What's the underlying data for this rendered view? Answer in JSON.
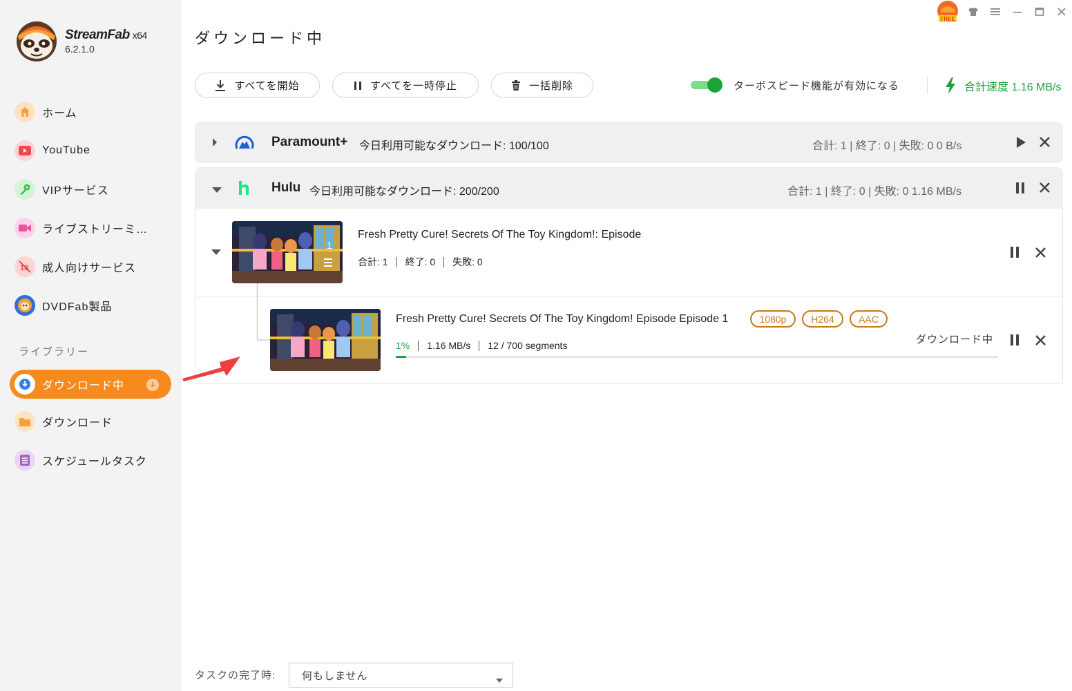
{
  "app": {
    "brand": "StreamFab",
    "arch": "x64",
    "version": "6.2.1.0"
  },
  "sidebar": {
    "items": [
      {
        "label": "ホーム",
        "icon": "home-icon",
        "color": "#f7a13b"
      },
      {
        "label": "YouTube",
        "icon": "youtube-icon",
        "color": "#f0484c"
      },
      {
        "label": "VIPサービス",
        "icon": "key-icon",
        "color": "#3fbf4a"
      },
      {
        "label": "ライブストリーミ…",
        "icon": "video-camera-icon",
        "color": "#f04fa0"
      },
      {
        "label": "成人向けサービス",
        "icon": "adult-restricted-icon",
        "color": "#f0484c"
      },
      {
        "label": "DVDFab製品",
        "icon": "dvdfab-logo-icon",
        "color": "#2f6fd6"
      }
    ],
    "library_title": "ライブラリー",
    "library_items": [
      {
        "label": "ダウンロード中",
        "icon": "download-icon",
        "active": true
      },
      {
        "label": "ダウンロード",
        "icon": "folder-icon",
        "color": "#f7a13b"
      },
      {
        "label": "スケジュールタスク",
        "icon": "schedule-list-icon",
        "color": "#a064c8"
      }
    ]
  },
  "header": {
    "title": "ダウンロード中",
    "free_badge": "FREE"
  },
  "toolbar": {
    "start_all": "すべてを開始",
    "pause_all": "すべてを一時停止",
    "delete_all": "一括削除",
    "turbo_label": "ターボスピード機能が有効になる",
    "turbo_enabled": true,
    "total_speed": "合計速度 1.16 MB/s"
  },
  "groups": [
    {
      "service": "Paramount+",
      "quota": "今日利用可能なダウンロード: 100/100",
      "stats": "合計: 1 | 終了: 0 | 失敗: 0    0 B/s",
      "expanded": false
    },
    {
      "service": "Hulu",
      "quota": "今日利用可能なダウンロード: 200/200",
      "stats": "合計: 1 | 終了: 0 | 失敗: 0    1.16 MB/s",
      "expanded": true
    }
  ],
  "series": {
    "title": "Fresh Pretty Cure! Secrets Of The Toy Kingdom!: Episode",
    "total": "合計: 1",
    "done": "終了: 0",
    "failed": "失敗: 0",
    "thumb_count": "1"
  },
  "episode": {
    "title": "Fresh Pretty Cure! Secrets Of The Toy Kingdom! Episode Episode 1",
    "tags": [
      "1080p",
      "H264",
      "AAC"
    ],
    "percent_text": "1%",
    "speed": "1.16 MB/s",
    "segments": "12 / 700 segments",
    "progress": 0.017,
    "status": "ダウンロード中"
  },
  "footer": {
    "label": "タスクの完了時:",
    "selected": "何もしません"
  },
  "colors": {
    "accent": "#f78a1f",
    "green": "#1aa33a",
    "tag": "#c87a1a"
  }
}
